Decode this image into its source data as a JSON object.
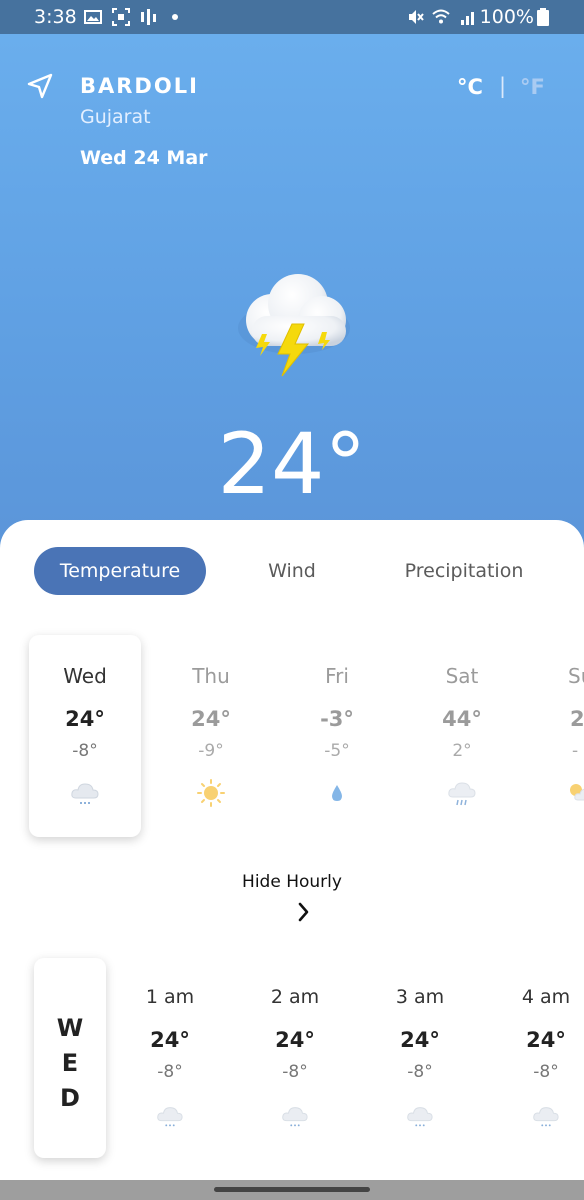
{
  "status_bar": {
    "time": "3:38",
    "battery_text": "100%",
    "icons": [
      "image-icon",
      "screenshot-icon",
      "signal-bars-icon",
      "dot-icon",
      "mute-icon",
      "wifi-icon",
      "cell-signal-icon",
      "battery-icon"
    ]
  },
  "location": {
    "city": "BARDOLI",
    "state": "Gujarat",
    "date": "Wed 24 Mar"
  },
  "units": {
    "celsius": "°C",
    "separator": "|",
    "fahrenheit": "°F",
    "selected": "celsius"
  },
  "current": {
    "temperature": "24°",
    "condition_icon": "thunderstorm-icon"
  },
  "tabs": [
    {
      "label": "Temperature",
      "active": true
    },
    {
      "label": "Wind",
      "active": false
    },
    {
      "label": "Precipitation",
      "active": false
    }
  ],
  "daily": [
    {
      "day": "Wed",
      "high": "24°",
      "low": "-8°",
      "icon": "cloud-icon",
      "selected": true
    },
    {
      "day": "Thu",
      "high": "24°",
      "low": "-9°",
      "icon": "sun-icon",
      "selected": false
    },
    {
      "day": "Fri",
      "high": "-3°",
      "low": "-5°",
      "icon": "raindrop-icon",
      "selected": false
    },
    {
      "day": "Sat",
      "high": "44°",
      "low": "2°",
      "icon": "rain-cloud-icon",
      "selected": false
    },
    {
      "day": "Su",
      "high": "2",
      "low": "-",
      "icon": "sun-cloud-icon",
      "selected": false
    }
  ],
  "hide_hourly_label": "Hide Hourly",
  "hourly_day_letters": [
    "W",
    "E",
    "D"
  ],
  "hourly": [
    {
      "time": "1 am",
      "high": "24°",
      "low": "-8°",
      "icon": "cloud-icon"
    },
    {
      "time": "2 am",
      "high": "24°",
      "low": "-8°",
      "icon": "cloud-icon"
    },
    {
      "time": "3 am",
      "high": "24°",
      "low": "-8°",
      "icon": "cloud-icon"
    },
    {
      "time": "4 am",
      "high": "24°",
      "low": "-8°",
      "icon": "cloud-icon"
    }
  ],
  "colors": {
    "hero_top": "#6aaeed",
    "hero_bottom": "#5b95d9",
    "active_tab": "#4a74b6",
    "status_bar": "#46729e"
  }
}
